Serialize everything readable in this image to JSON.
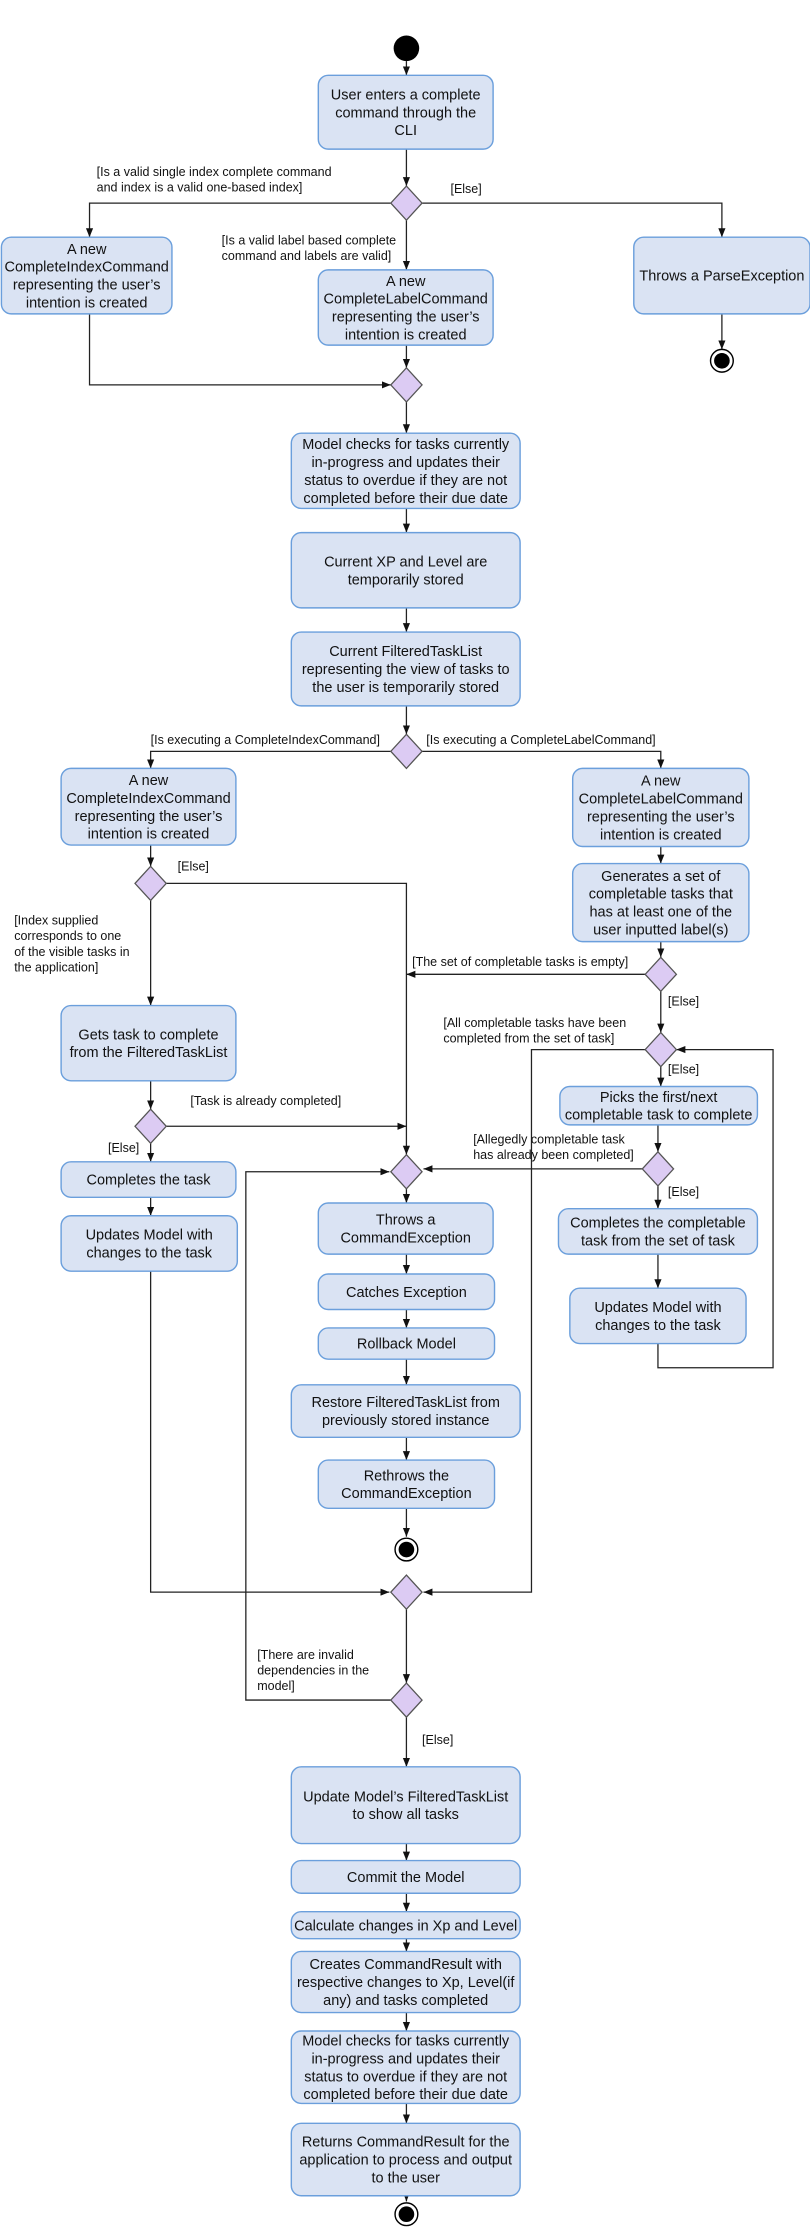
{
  "colors": {
    "action_fill": "#dae3f3",
    "action_border": "#6b9fdc",
    "decision_fill": "#dccbf3",
    "line": "#222222",
    "node": "#000000"
  },
  "actions": {
    "user_enters": [
      "User enters a complete",
      "command through the",
      "CLI"
    ],
    "new_index_cmd_1": [
      "A new",
      "CompleteIndexCommand",
      "representing the user’s",
      "intention is created"
    ],
    "new_label_cmd_1": [
      "A new",
      "CompleteLabelCommand",
      "representing the user’s",
      "intention is created"
    ],
    "throws_parse": [
      "Throws a ParseException"
    ],
    "model_checks_1": [
      "Model checks for tasks currently",
      "in-progress and updates their",
      "status to overdue if they are not",
      "completed before their due date"
    ],
    "store_xp": [
      "Current XP and Level are",
      "temporarily stored"
    ],
    "store_list": [
      "Current FilteredTaskList",
      "representing the view of tasks to",
      "the user is temporarily stored"
    ],
    "new_index_cmd_2": [
      "A new",
      "CompleteIndexCommand",
      "representing the user’s",
      "intention is created"
    ],
    "new_label_cmd_2": [
      "A new",
      "CompleteLabelCommand",
      "representing the user’s",
      "intention is created"
    ],
    "gets_task": [
      "Gets task to complete",
      "from the FilteredTaskList"
    ],
    "completes_task": [
      "Completes the task"
    ],
    "updates_model_left": [
      "Updates Model with",
      "changes to the task"
    ],
    "generates_set": [
      "Generates a set of",
      "completable tasks that",
      "has at least one of the",
      "user inputted label(s)"
    ],
    "picks_next": [
      "Picks the first/next",
      "completable task to complete"
    ],
    "completes_completable": [
      "Completes the completable",
      "task from the set of task"
    ],
    "updates_model_right": [
      "Updates Model with",
      "changes to the task"
    ],
    "throws_command_ex": [
      "Throws a",
      "CommandException"
    ],
    "catches_ex": [
      "Catches Exception"
    ],
    "rollback": [
      "Rollback Model"
    ],
    "restore_list": [
      "Restore FilteredTaskList from",
      "previously stored instance"
    ],
    "rethrows": [
      "Rethrows the",
      "CommandException"
    ],
    "update_filtered": [
      "Update Model’s FilteredTaskList",
      "to show all tasks"
    ],
    "commit": [
      "Commit the Model"
    ],
    "calc_xp": [
      "Calculate changes in Xp and Level"
    ],
    "creates_result": [
      "Creates CommandResult with",
      "respective changes to Xp, Level(if",
      "any) and tasks completed"
    ],
    "model_checks_2": [
      "Model checks for tasks currently",
      "in-progress and updates their",
      "status to overdue if they are not",
      "completed before their due date"
    ],
    "returns_result": [
      "Returns CommandResult for the",
      "application to process and output",
      "to the user"
    ]
  },
  "guards": {
    "valid_index": [
      "[Is a valid single index complete command",
      "and index is a valid one-based index]"
    ],
    "parse_else": [
      "[Else]"
    ],
    "valid_label": [
      "[Is a valid label based complete",
      "command and labels are valid]"
    ],
    "exec_index": [
      "[Is executing a CompleteIndexCommand]"
    ],
    "exec_label": [
      "[Is executing a CompleteLabelCommand]"
    ],
    "index_else": [
      "[Else]"
    ],
    "index_valid": [
      "[Index supplied",
      "corresponds to one",
      "of the visible tasks in",
      "the application]"
    ],
    "already_completed": [
      "[Task is already completed]"
    ],
    "completed_else": [
      "[Else]"
    ],
    "set_empty": [
      "[The set of completable tasks is empty]"
    ],
    "set_else": [
      "[Else]"
    ],
    "all_done": [
      "[All completable tasks have been",
      "completed from the set of task]"
    ],
    "loop_else": [
      "[Else]"
    ],
    "allegedly": [
      "[Allegedly completable task",
      "has already been completed]"
    ],
    "alleg_else": [
      "[Else]"
    ],
    "invalid_deps": [
      "[There are invalid",
      "dependencies in the",
      "model]"
    ],
    "final_else": [
      "[Else]"
    ]
  }
}
